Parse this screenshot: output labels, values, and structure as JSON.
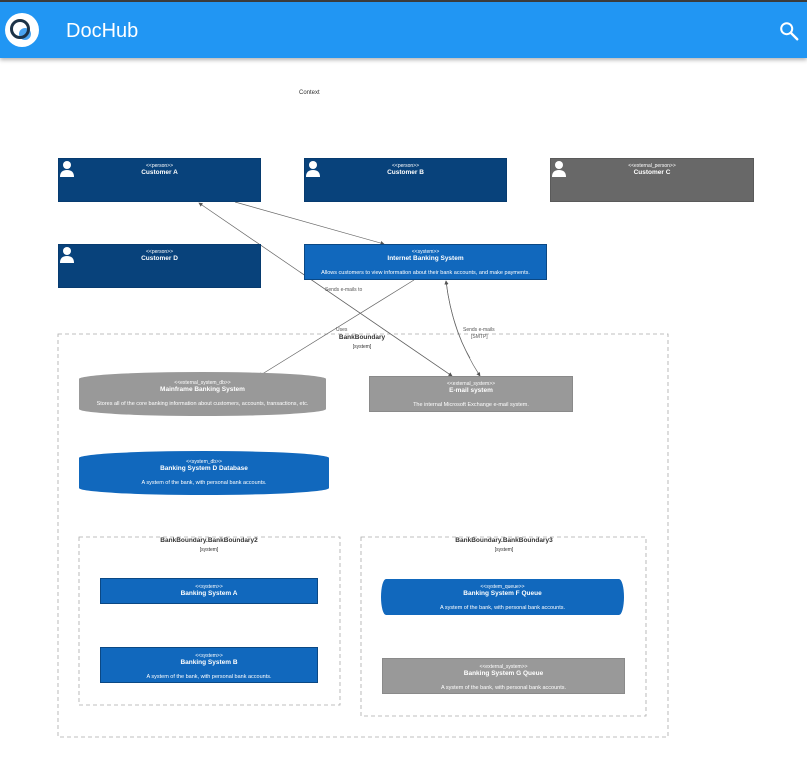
{
  "app": {
    "title": "DocHub"
  },
  "icons": {
    "logo": "dochub-logo-icon",
    "search": "search-icon",
    "person": "person-icon"
  },
  "colors": {
    "appbar": "#2196f3",
    "person": "#08427b",
    "system": "#1168bd",
    "external": "#999999",
    "external_person": "#686868"
  },
  "diagram": {
    "title": "Context",
    "persons": [
      {
        "stereotype": "<<person>>",
        "name": "Customer A"
      },
      {
        "stereotype": "<<person>>",
        "name": "Customer B"
      },
      {
        "stereotype": "<<external_person>>",
        "name": "Customer C"
      },
      {
        "stereotype": "<<person>>",
        "name": "Customer D"
      }
    ],
    "internet_banking": {
      "stereotype": "<<system>>",
      "name": "Internet Banking System",
      "description": "Allows customers to view information about their bank accounts, and make payments."
    },
    "boundaries": [
      {
        "title": "BankBoundary",
        "tag": "[system]"
      },
      {
        "title": "BankBoundary.BankBoundary2",
        "tag": "[system]"
      },
      {
        "title": "BankBoundary.BankBoundary3",
        "tag": "[system]"
      }
    ],
    "mainframe": {
      "stereotype": "<<external_system_db>>",
      "name": "Mainframe Banking System",
      "description": "Stores all of the core banking information about customers, accounts, transactions, etc."
    },
    "email": {
      "stereotype": "<<external_system>>",
      "name": "E-mail system",
      "description": "The internal Microsoft Exchange e-mail system."
    },
    "system_d": {
      "stereotype": "<<system_db>>",
      "name": "Banking System D Database",
      "description": "A system of the bank, with personal bank accounts."
    },
    "system_a": {
      "stereotype": "<<system>>",
      "name": "Banking System A"
    },
    "system_b": {
      "stereotype": "<<system>>",
      "name": "Banking System B",
      "description": "A system of the bank, with personal bank accounts."
    },
    "system_f": {
      "stereotype": "<<system_queue>>",
      "name": "Banking System F Queue",
      "description": "A system of the bank, with personal bank accounts."
    },
    "system_g": {
      "stereotype": "<<external_system>>",
      "name": "Banking System G Queue",
      "description": "A system of the bank, with personal bank accounts."
    },
    "relations": [
      {
        "label": "Sends e-mails to"
      },
      {
        "label": "Uses"
      },
      {
        "label": "Sends e-mails",
        "tech": "[SMTP]"
      }
    ]
  }
}
